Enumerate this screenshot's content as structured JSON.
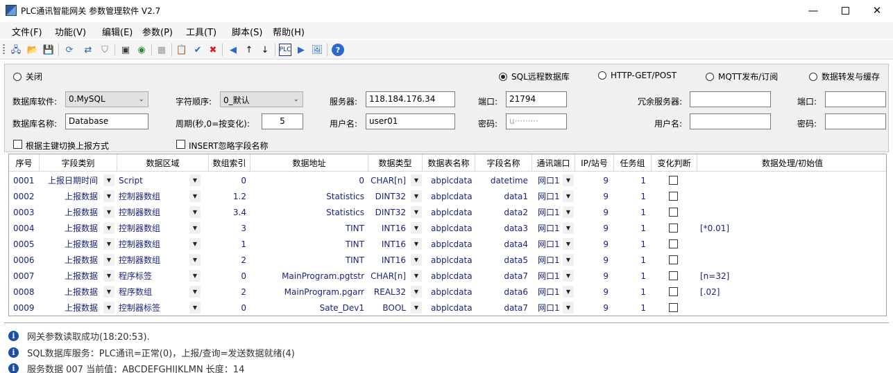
{
  "window": {
    "title": "PLC通讯智能网关 参数管理软件 V2.7"
  },
  "menu": [
    {
      "label": "文件(F)"
    },
    {
      "label": "功能(V)"
    },
    {
      "label": "编辑(E)"
    },
    {
      "label": "参数(P)"
    },
    {
      "label": "工具(T)"
    },
    {
      "label": "脚本(S)"
    },
    {
      "label": "帮助(H)"
    }
  ],
  "toolbar_icons": [
    "network-icon",
    "open-folder-icon",
    "save-icon",
    "refresh-icon",
    "connect-icon",
    "disconnect-icon",
    "book-icon",
    "web-icon",
    "grid-icon",
    "paste-icon",
    "check-icon",
    "cancel-icon",
    "prev-icon",
    "up-icon",
    "down-icon",
    "plc-icon",
    "next-icon",
    "image-icon",
    "help-icon"
  ],
  "modes": {
    "close": "关闭",
    "sql": "SQL远程数据库",
    "http": "HTTP-GET/POST",
    "mqtt": "MQTT发布/订阅",
    "forward": "数据转发与缓存",
    "selected": "sql"
  },
  "config": {
    "db_software_label": "数据库软件:",
    "db_software_value": "0.MySQL",
    "char_order_label": "字符顺序:",
    "char_order_value": "0_默认",
    "server_label": "服务器:",
    "server_value": "118.184.176.34",
    "port_label": "端口:",
    "port_value": "21794",
    "redundant_label": "冗余服务器:",
    "redundant_value": "",
    "port2_label": "端口:",
    "port2_value": "",
    "db_name_label": "数据库名称:",
    "db_name_value": "Database",
    "period_label": "周期(秒,0=按变化):",
    "period_value": "5",
    "user_label": "用户名:",
    "user_value": "user01",
    "pwd_label": "密码:",
    "pwd_value": "u·········",
    "user2_label": "用户名:",
    "user2_value": "",
    "pwd2_label": "密码:",
    "pwd2_value": "",
    "pk_switch_label": "根据主键切换上报方式",
    "insert_ignore_label": "INSERT忽略字段名称"
  },
  "table": {
    "headers": [
      "序号",
      "字段类别",
      "数据区域",
      "数组索引",
      "数据地址",
      "数据类型",
      "数据表名称",
      "字段名称",
      "通讯端口",
      "IP/站号",
      "任务组",
      "变化判断",
      "数据处理/初始值"
    ],
    "rows": [
      [
        "0001",
        "上报日期时间",
        "Script",
        "0",
        "0",
        "CHAR[n]",
        "abplcdata",
        "datetime",
        "网口1",
        "9",
        "1",
        ""
      ],
      [
        "0002",
        "上报数据",
        "控制器数组",
        "1.2",
        "Statistics",
        "DINT32",
        "abplcdata",
        "data1",
        "网口1",
        "9",
        "1",
        ""
      ],
      [
        "0003",
        "上报数据",
        "控制器数组",
        "3.4",
        "Statistics",
        "DINT32",
        "abplcdata",
        "data2",
        "网口1",
        "9",
        "1",
        ""
      ],
      [
        "0004",
        "上报数据",
        "控制器数组",
        "3",
        "TINT",
        "INT16",
        "abplcdata",
        "data3",
        "网口1",
        "9",
        "1",
        "[*0.01]"
      ],
      [
        "0005",
        "上报数据",
        "控制器数组",
        "1",
        "TINT",
        "INT16",
        "abplcdata",
        "data4",
        "网口1",
        "9",
        "1",
        ""
      ],
      [
        "0006",
        "上报数据",
        "控制器数组",
        "2",
        "TINT",
        "INT16",
        "abplcdata",
        "data5",
        "网口1",
        "9",
        "1",
        ""
      ],
      [
        "0007",
        "上报数据",
        "程序标签",
        "0",
        "MainProgram.pgtstr",
        "CHAR[n]",
        "abplcdata",
        "data7",
        "网口1",
        "9",
        "1",
        "[n=32]"
      ],
      [
        "0008",
        "上报数据",
        "程序数组",
        "2",
        "MainProgram.pgarr",
        "REAL32",
        "abplcdata",
        "data6",
        "网口1",
        "9",
        "1",
        "[.02]"
      ],
      [
        "0009",
        "上报数据",
        "控制器标签",
        "0",
        "Sate_Dev1",
        "BOOL",
        "abplcdata",
        "data7",
        "网口1",
        "9",
        "1",
        ""
      ]
    ]
  },
  "log": [
    "网关参数读取成功(18:20:53).",
    "SQL数据库服务：PLC通讯=正常(0)，上报/查询=发送数据就绪(4)",
    "服务数据 007 当前值：ABCDEFGHIJKLMN  长度：14"
  ]
}
